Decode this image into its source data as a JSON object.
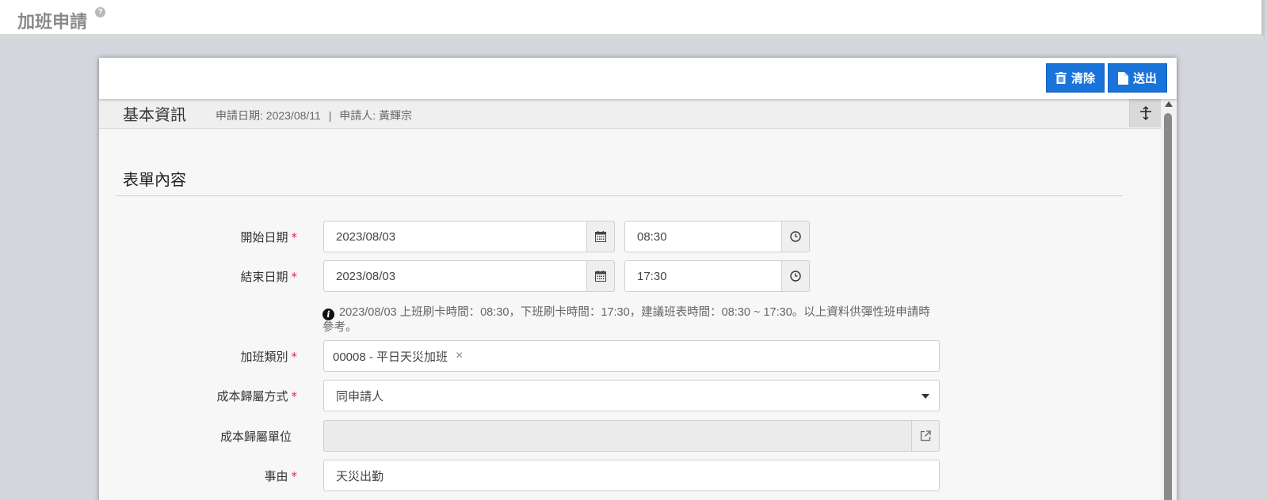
{
  "header": {
    "title": "加班申請",
    "help_icon": "question-circle-icon"
  },
  "toolbar": {
    "clear_label": "清除",
    "submit_label": "送出",
    "button_color": "#1a73d9"
  },
  "basic_info": {
    "title": "基本資訊",
    "apply_date": "申請日期: 2023/08/11",
    "separator": "|",
    "applicant": "申請人: 黃輝宗",
    "expand_icon": "expand-icon"
  },
  "form": {
    "heading": "表單內容",
    "start": {
      "label": "開始日期",
      "date": "2023/08/03",
      "time": "08:30"
    },
    "end": {
      "label": "結束日期",
      "date": "2023/08/03",
      "time": "17:30"
    },
    "hint": "2023/08/03 上班刷卡時間：08:30，下班刷卡時間：17:30，建議班表時間：08:30 ~ 17:30。以上資料供彈性班申請時參考。",
    "overtime_type": {
      "label": "加班類別",
      "value": "00008 - 平日天災加班",
      "remove": "×"
    },
    "cost_method": {
      "label": "成本歸屬方式",
      "value": "同申請人"
    },
    "cost_unit": {
      "label": "成本歸屬單位",
      "value": ""
    },
    "reason": {
      "label": "事由",
      "value": "天災出勤"
    },
    "required_mark": "*",
    "required_color": "#e0245e"
  }
}
